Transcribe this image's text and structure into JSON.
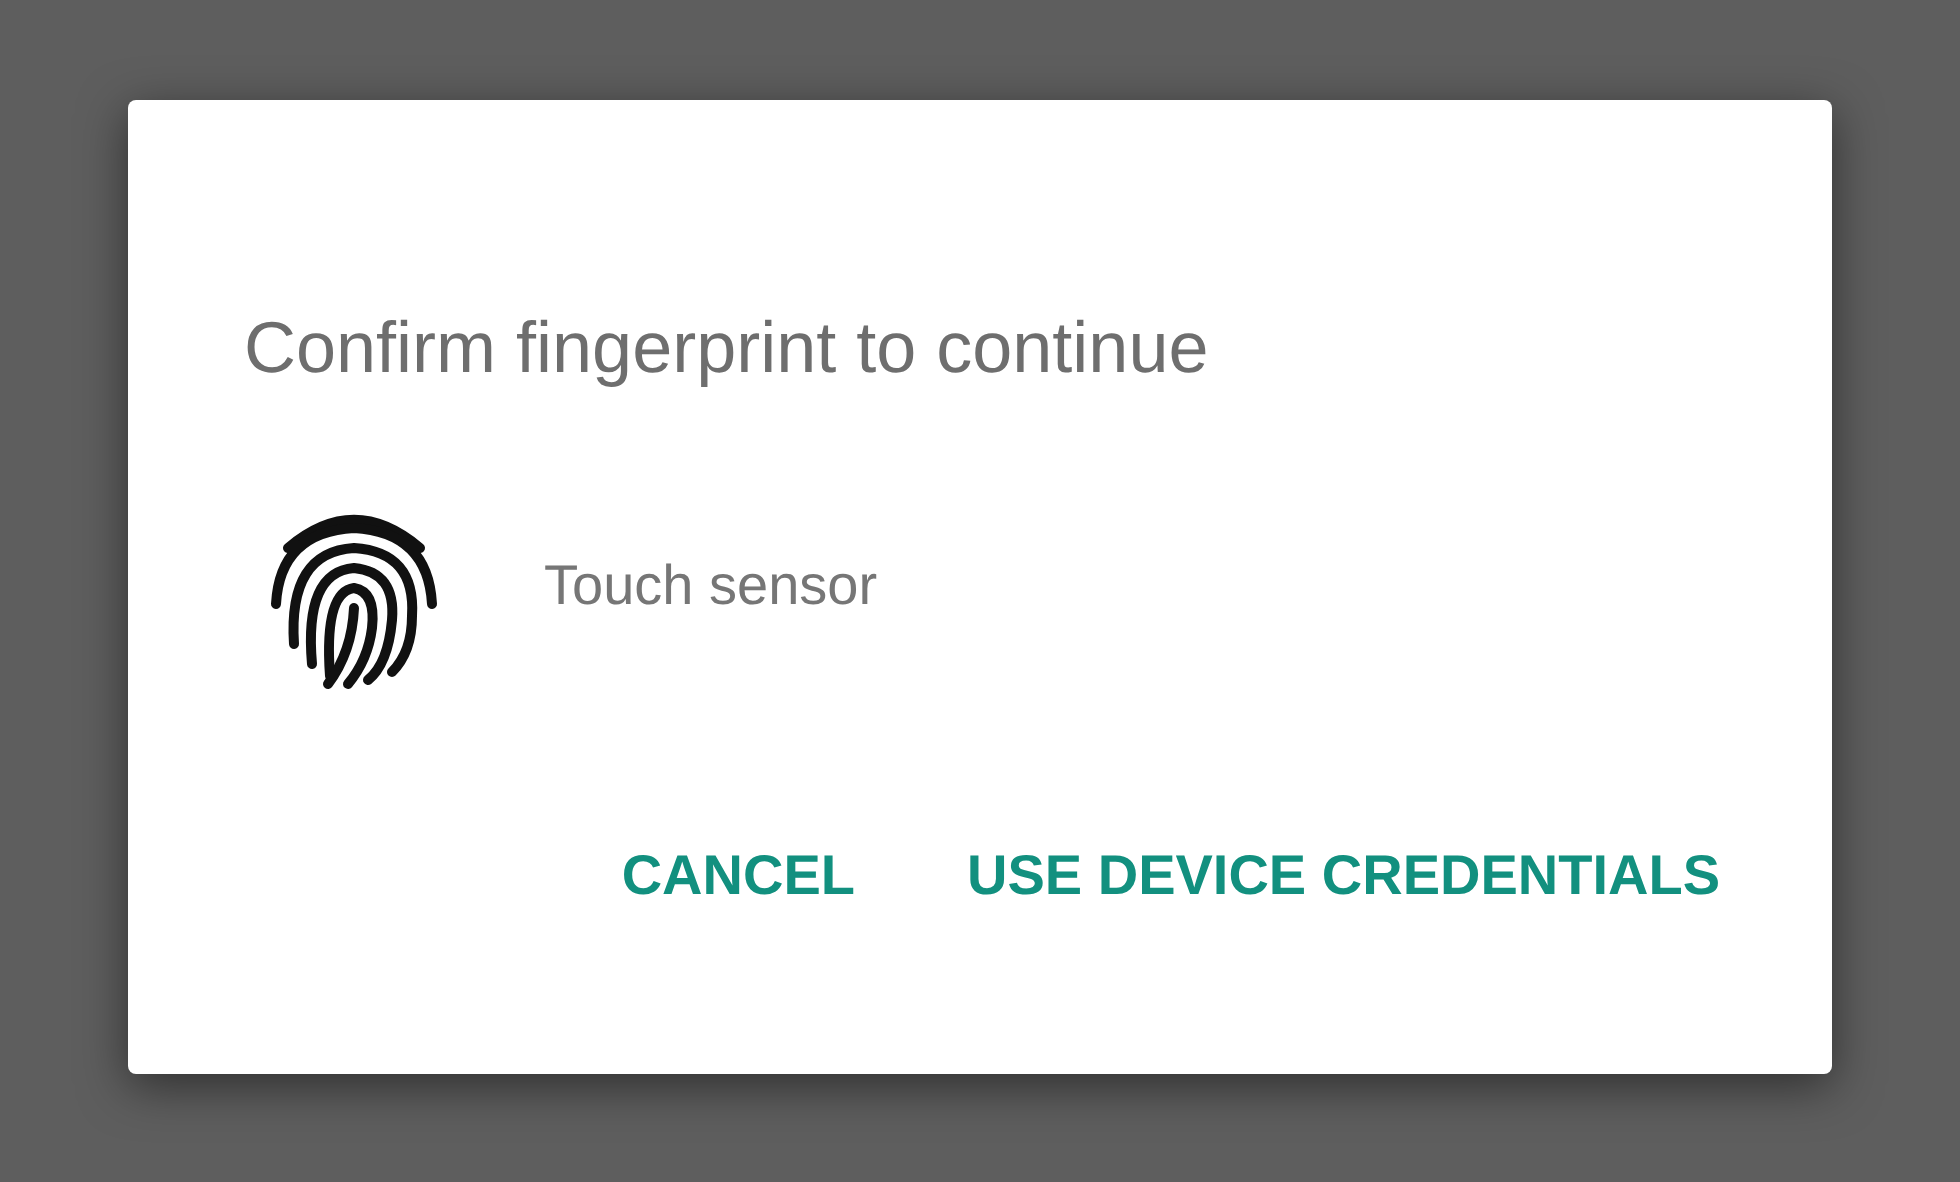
{
  "dialog": {
    "title": "Confirm fingerprint to continue",
    "message": "Touch sensor",
    "buttons": [
      "CANCEL",
      "USE DEVICE CREDENTIALS"
    ]
  }
}
